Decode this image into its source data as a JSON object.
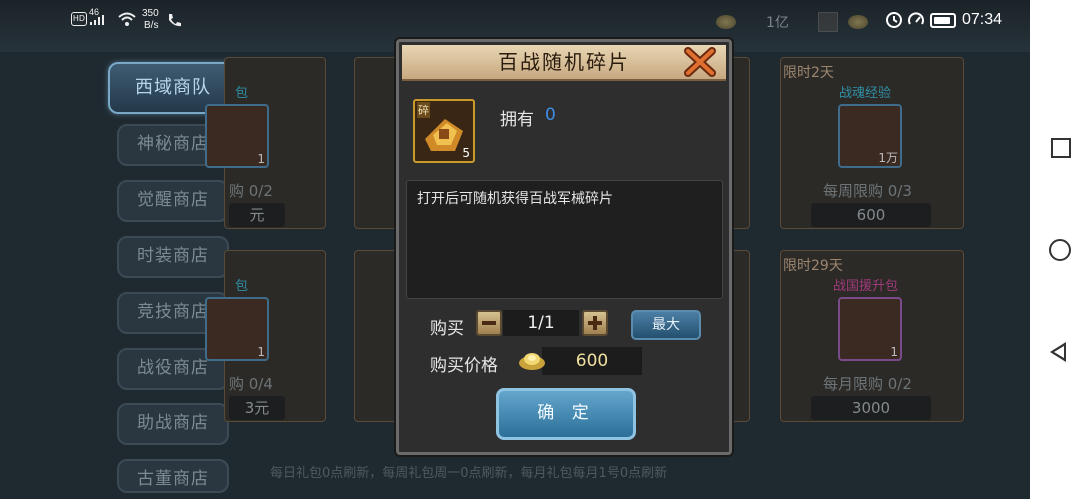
{
  "status_bar": {
    "network": "46",
    "hd": "HD",
    "speed_value": "350",
    "speed_unit": "B/s",
    "time": "07:34",
    "battery_level": 0.9
  },
  "top_bar": {
    "currency_amount": "1亿",
    "coin_icon": "gold-coin-icon",
    "ingot_icon": "gold-ingot-icon"
  },
  "side_menu": {
    "items": [
      {
        "label": "西域商队",
        "active": true
      },
      {
        "label": "神秘商店",
        "active": false
      },
      {
        "label": "觉醒商店",
        "active": false
      },
      {
        "label": "时装商店",
        "active": false
      },
      {
        "label": "竞技商店",
        "active": false
      },
      {
        "label": "战役商店",
        "active": false
      },
      {
        "label": "助战商店",
        "active": false
      },
      {
        "label": "古董商店",
        "active": false
      }
    ]
  },
  "shop_cards": {
    "left_top": {
      "name": "包",
      "icon_count": "1",
      "limit": "购 0/2",
      "price": "元"
    },
    "left_bottom": {
      "name": "包",
      "icon_count": "1",
      "limit": "购 0/4",
      "price": "3元"
    },
    "right_top": {
      "tag": "限时2天",
      "name": "战魂经验",
      "icon_count": "1万",
      "limit": "每周限购 0/3",
      "price": "600"
    },
    "right_bottom": {
      "tag": "限时29天",
      "name": "战国援升包",
      "icon_count": "1",
      "limit": "每月限购 0/2",
      "price": "3000"
    }
  },
  "footer_note": "每日礼包0点刷新，每周礼包周一0点刷新，每月礼包每月1号0点刷新",
  "dialog": {
    "title": "百战随机碎片",
    "close_icon": "close-x-icon",
    "item": {
      "tag": "碎",
      "count": "5"
    },
    "own_label": "拥有",
    "own_value": "0",
    "description": "打开后可随机获得百战军械碎片",
    "buy_label": "购买",
    "quantity": "1/1",
    "max_label": "最大",
    "price_label": "购买价格",
    "price_value": "600",
    "confirm_label": "确 定"
  },
  "colors": {
    "dialog_header": "#d9c098",
    "confirm_button": "#3f88b4",
    "own_value": "#3d8ee6",
    "active_tab": "#3f5c72"
  }
}
